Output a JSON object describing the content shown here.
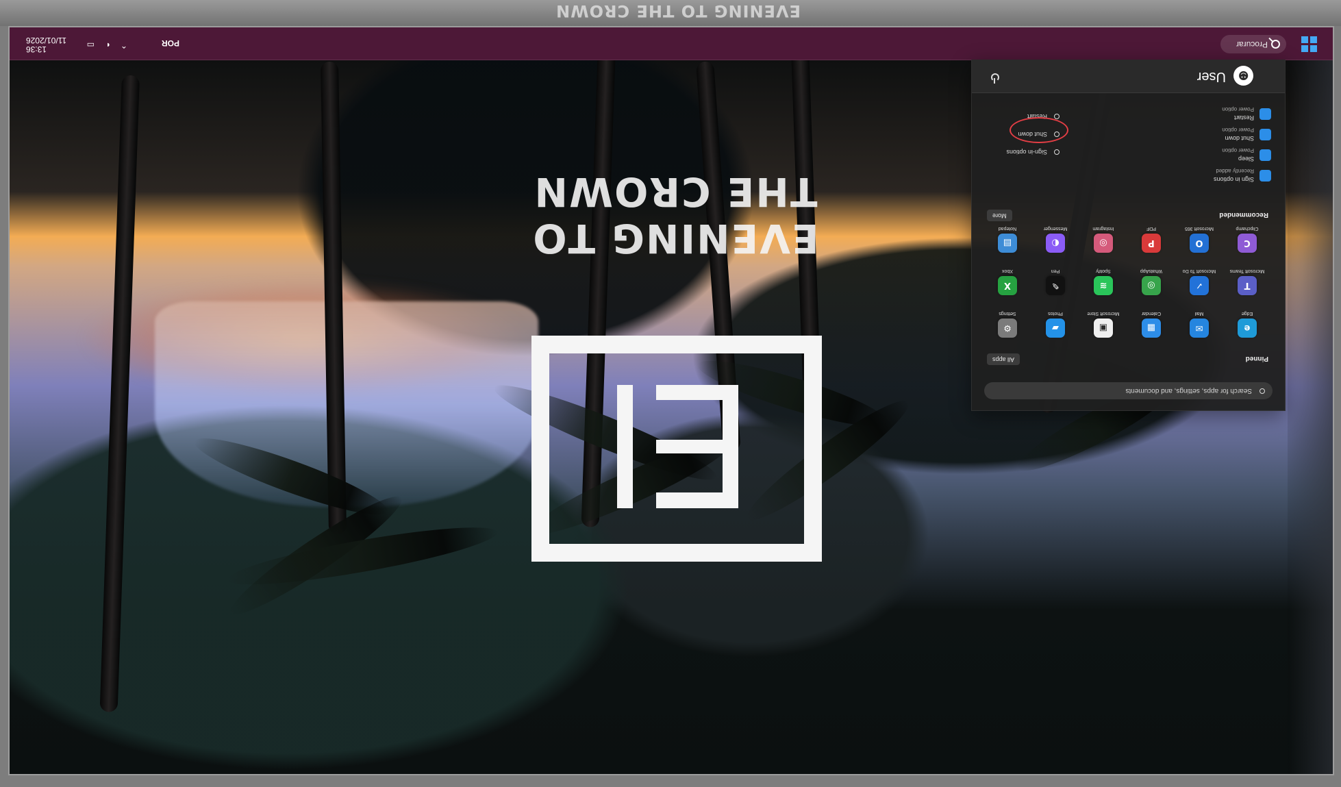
{
  "screen": {
    "window_title": "EVENING TO THE CROWN"
  },
  "wallpaper": {
    "text": "EVENING TO THE CROWN"
  },
  "taskbar": {
    "search_label": "Procurar",
    "language": "POR",
    "time": "13:36",
    "date": "11/01/2026"
  },
  "start_menu": {
    "search_placeholder": "Search for apps, settings, and documents",
    "pinned_title": "Pinned",
    "all_button": "All apps",
    "recommended_title": "Recommended",
    "more_button": "More",
    "pinned_apps": [
      {
        "label": "Edge",
        "icon": "edge-icon",
        "color": "#1f9bd8"
      },
      {
        "label": "Mail",
        "icon": "mail-icon",
        "color": "#2585df"
      },
      {
        "label": "Calendar",
        "icon": "calendar-icon",
        "color": "#2d8de8"
      },
      {
        "label": "Microsoft Store",
        "icon": "store-icon",
        "color": "#efefef"
      },
      {
        "label": "Photos",
        "icon": "photos-icon",
        "color": "#2492e8"
      },
      {
        "label": "Settings",
        "icon": "settings-icon",
        "color": "#7b7b7b"
      },
      {
        "label": "Microsoft Teams",
        "icon": "teams-icon",
        "color": "#5b5fc7"
      },
      {
        "label": "Microsoft To Do",
        "icon": "todo-icon",
        "color": "#2272d9"
      },
      {
        "label": "WhatsApp",
        "icon": "whatsapp-icon",
        "color": "#37a44b"
      },
      {
        "label": "Spotify",
        "icon": "spotify-icon",
        "color": "#2ac55a"
      },
      {
        "label": "Pen",
        "icon": "pen-icon",
        "color": "#111111"
      },
      {
        "label": "Xbox",
        "icon": "xbox-icon",
        "color": "#26a241"
      },
      {
        "label": "Clipchamp",
        "icon": "clipchamp-icon",
        "color": "#8f5bd5"
      },
      {
        "label": "Microsoft 365",
        "icon": "office-icon",
        "color": "#2370d4"
      },
      {
        "label": "PDF",
        "icon": "pdf-icon",
        "color": "#d93a3a"
      },
      {
        "label": "Instagram",
        "icon": "instagram-icon",
        "color": "#d55a7b"
      },
      {
        "label": "Messenger",
        "icon": "messenger-icon",
        "color": "#8b5cf6"
      },
      {
        "label": "Notepad",
        "icon": "notepad-icon",
        "color": "#3d8cd6"
      }
    ],
    "recommended_items": [
      {
        "name": "Sign in options",
        "meta": "Recently added"
      },
      {
        "name": "Sleep",
        "meta": "Power option"
      },
      {
        "name": "Shut down",
        "meta": "Power option"
      },
      {
        "name": "Restart",
        "meta": "Power option"
      }
    ],
    "power_options": [
      {
        "label": "Sign-in options"
      },
      {
        "label": "Shut down"
      },
      {
        "label": "Restart"
      }
    ],
    "user_name": "User"
  }
}
